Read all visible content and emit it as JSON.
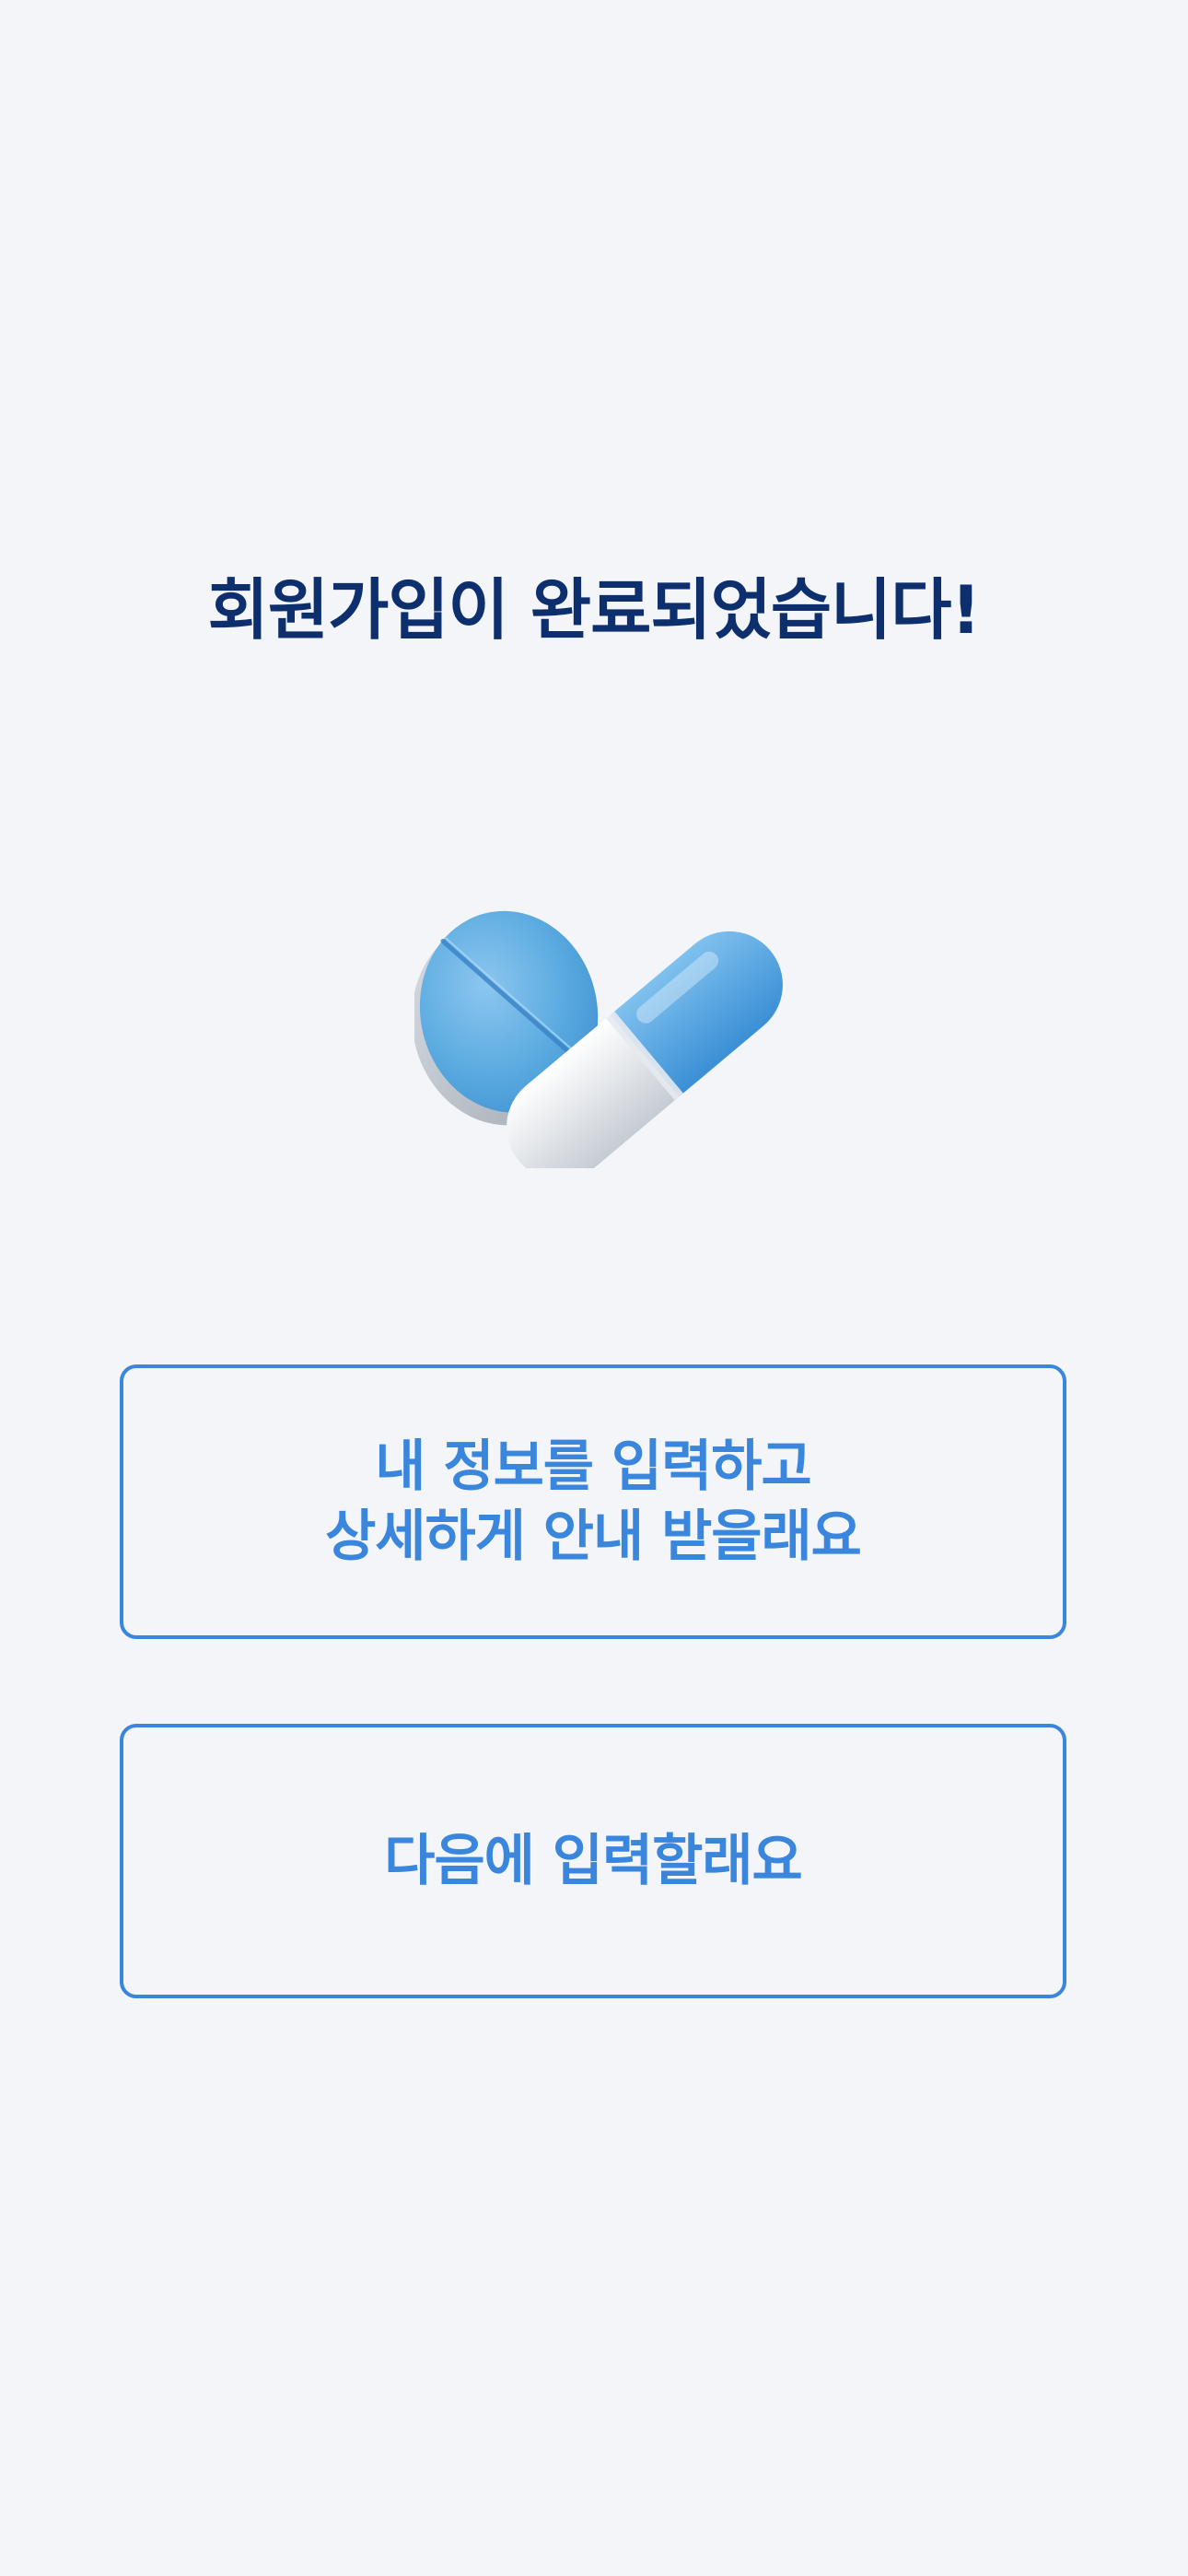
{
  "title": "회원가입이 완료되었습니다!",
  "illustration": {
    "icon": "pill-capsule-icon"
  },
  "buttons": {
    "detail_line1": "내 정보를 입력하고",
    "detail_line2": "상세하게 안내 받을래요",
    "later": "다음에 입력할래요"
  },
  "colors": {
    "background": "#f3f5f8",
    "title": "#0e2f6e",
    "accent": "#3a86dc"
  }
}
